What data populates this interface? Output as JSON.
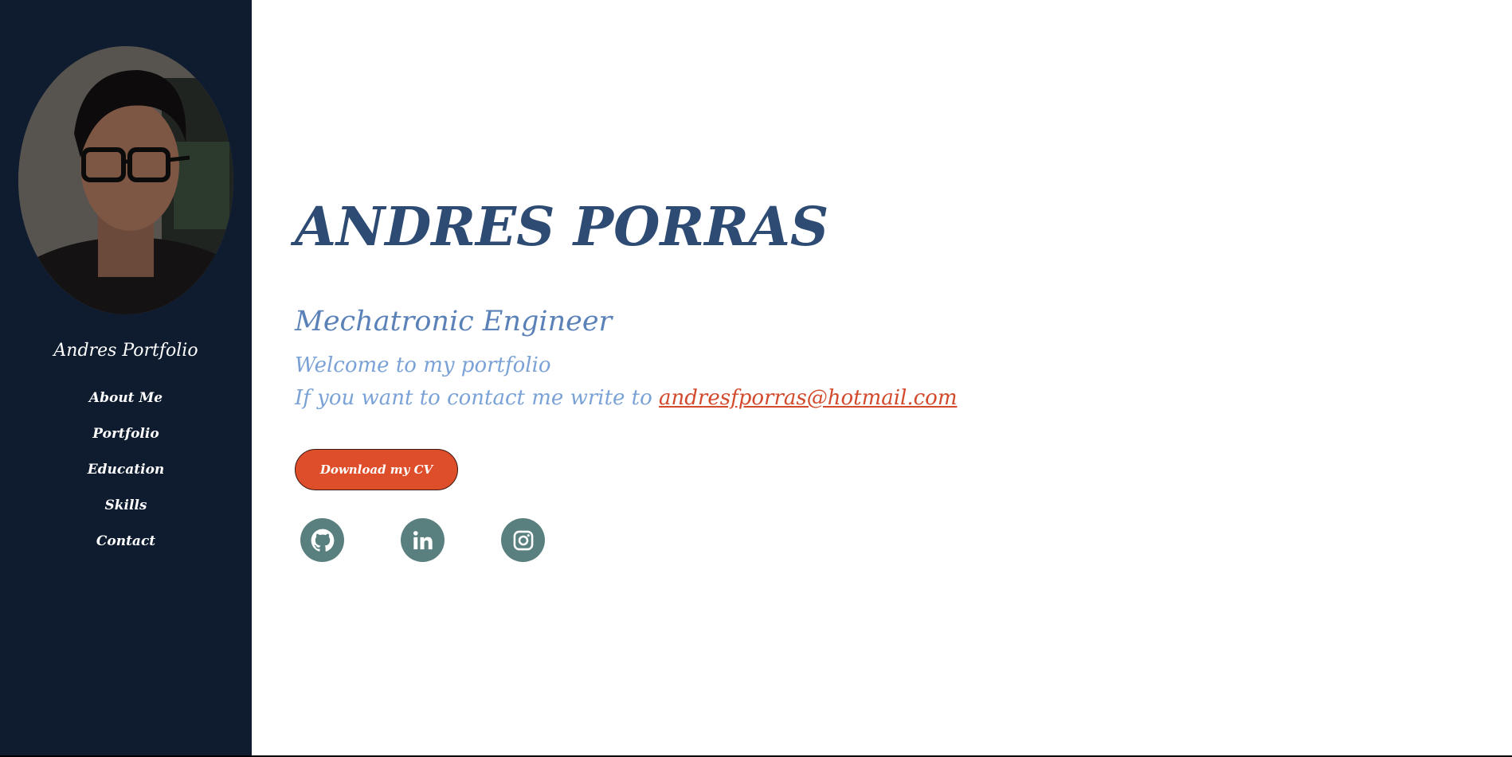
{
  "sidebar": {
    "site_title": "Andres Portfolio",
    "avatar_alt": "profile photo",
    "nav": [
      {
        "label": "About Me"
      },
      {
        "label": "Portfolio"
      },
      {
        "label": "Education"
      },
      {
        "label": "Skills"
      },
      {
        "label": "Contact"
      }
    ]
  },
  "hero": {
    "name": "ANDRES PORRAS",
    "role": "Mechatronic Engineer",
    "welcome": "Welcome to my portfolio",
    "contact_prefix": "If you want to contact me write to ",
    "email": "andresfporras@hotmail.com",
    "cv_button": "Download my CV"
  },
  "social": [
    {
      "icon": "github-icon"
    },
    {
      "icon": "linkedin-icon"
    },
    {
      "icon": "instagram-icon"
    }
  ],
  "colors": {
    "sidebar_bg": "#0f1c2f",
    "name": "#2d4b73",
    "role": "#5b82b8",
    "text": "#7aa2d6",
    "accent": "#df4e2b",
    "social_bg": "#5a7f7f"
  }
}
